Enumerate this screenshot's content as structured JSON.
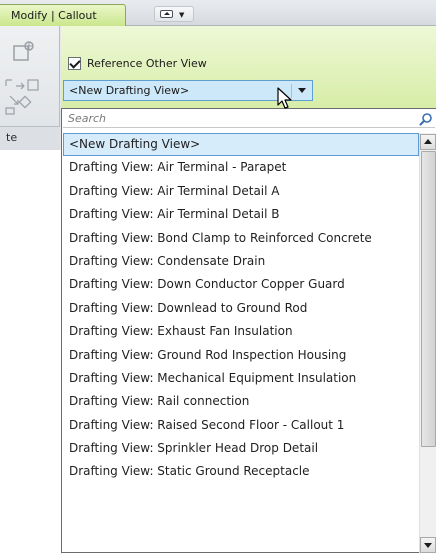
{
  "ribbon": {
    "tab_label": "Modify | Callout",
    "left_panel_footer": "te"
  },
  "reference": {
    "checkbox_label": "Reference Other View",
    "checked": true,
    "combo_value": "<New Drafting View>"
  },
  "dropdown": {
    "search_placeholder": "Search",
    "items": [
      "<New Drafting View>",
      "Drafting View: Air Terminal - Parapet",
      "Drafting View: Air Terminal Detail A",
      "Drafting View: Air Terminal Detail B",
      "Drafting View: Bond Clamp to Reinforced Concrete",
      "Drafting View: Condensate Drain",
      "Drafting View: Down Conductor Copper Guard",
      "Drafting View: Downlead to Ground Rod",
      "Drafting View: Exhaust Fan Insulation",
      "Drafting View: Ground Rod Inspection Housing",
      "Drafting View: Mechanical Equipment Insulation",
      "Drafting View: Rail connection",
      "Drafting View: Raised Second Floor - Callout 1",
      "Drafting View: Sprinkler Head Drop Detail",
      "Drafting View: Static Ground Receptacle"
    ],
    "selected_index": 0
  },
  "icons": {
    "search": "search-icon",
    "tab_menu": "window-menu-icon",
    "callout": "callout-icon",
    "sheet_placement": "sheet-placement-icon",
    "cursor": "mouse-pointer-icon"
  },
  "colors": {
    "active_tab": "#c8e68a",
    "selection_fill": "#d7ecfb",
    "selection_border": "#5c9bd3"
  }
}
